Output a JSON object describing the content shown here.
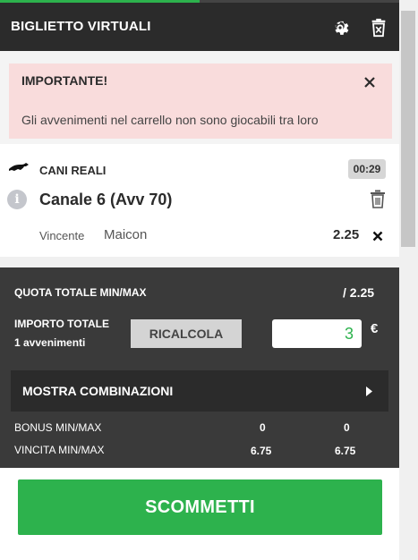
{
  "header": {
    "title": "BIGLIETTO VIRTUALI",
    "progress": 0.5
  },
  "alert": {
    "title": "IMPORTANTE!",
    "message": "Gli avvenimenti nel carrello non sono giocabili tra loro"
  },
  "bet": {
    "event": "CANI REALI",
    "time": "00:29",
    "info_symbol": "i",
    "channel": "Canale 6 (Avv 70)",
    "market": "Vincente",
    "selection": "Maicon",
    "odd": "2.25"
  },
  "summary": {
    "quota_label": "QUOTA TOTALE MIN/MAX",
    "quota_value": "/  2.25",
    "importo_label": "IMPORTO TOTALE",
    "events_count": "1 avvenimenti",
    "recalc_label": "RICALCOLA",
    "amount": "3",
    "currency": "€",
    "combinations_label": "MOSTRA COMBINAZIONI",
    "bonus_label": "BONUS MIN/MAX",
    "bonus_min": "0",
    "bonus_max": "0",
    "vincita_label": "VINCITA MIN/MAX",
    "vincita_min": "6.75",
    "vincita_max": "6.75"
  },
  "action": {
    "bet_label": "SCOMMETTI"
  },
  "icons": {
    "settings": "gear-icon",
    "clear": "trash-icon",
    "dog": "greyhound-icon",
    "info": "info-icon",
    "close": "close-icon",
    "arrow": "chevron-right-icon"
  },
  "colors": {
    "accent": "#2db24d",
    "header_bg": "#2b2b2b",
    "alert_bg": "#f9dcdc",
    "summary_bg": "#3a3a3a"
  }
}
